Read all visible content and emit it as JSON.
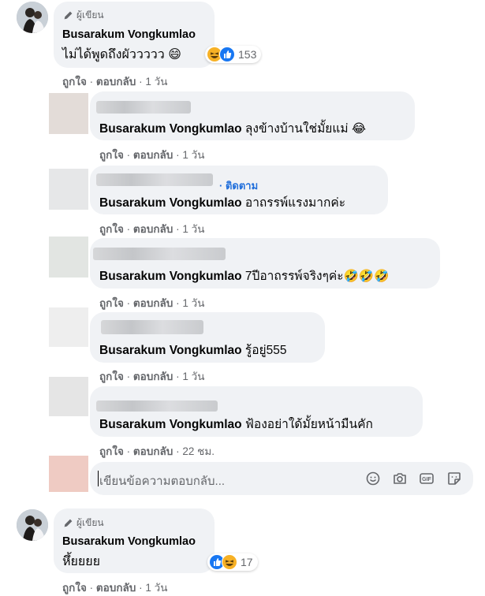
{
  "author_badge_label": "ผู้เขียน",
  "actions": {
    "like": "ถูกใจ",
    "reply": "ตอบกลับ",
    "sep": "·"
  },
  "comment1": {
    "author": "Busarakum Vongkumlao",
    "text": "ไม่ได้พูดถึงผัววววว 😄",
    "reaction_count": "153",
    "time": "1 วัน"
  },
  "replies": [
    {
      "author": "Busarakum Vongkumlao",
      "text": "ลุงข้างบ้านใช่มั้ยแม่ 😂",
      "time": "1 วัน"
    },
    {
      "follow_label": "ติดตาม",
      "author": "Busarakum Vongkumlao",
      "text": "อาถรรพ์แรงมากค่ะ",
      "time": "1 วัน"
    },
    {
      "author": "Busarakum Vongkumlao",
      "text": "7ปีอาถรรพ์จริงๆค่ะ🤣🤣🤣",
      "time": "1 วัน"
    },
    {
      "author": "Busarakum Vongkumlao",
      "text": "รู้อยู่555",
      "time": "1 วัน"
    },
    {
      "author": "Busarakum Vongkumlao",
      "text": "ฟ้องอย่าใด้มั้ยหน้ามืนคัก",
      "time": "22 ชม."
    }
  ],
  "reply_input": {
    "placeholder": "เขียนข้อความตอบกลับ..."
  },
  "reply_tools": [
    "emoji-icon",
    "camera-icon",
    "gif-icon",
    "sticker-icon"
  ],
  "comment2": {
    "author": "Busarakum Vongkumlao",
    "text": "หึ้ยยยย",
    "reaction_count": "17",
    "time": "1 วัน"
  },
  "colors": {
    "bubble": "#f0f2f5",
    "secondary_text": "#65676b",
    "link_blue": "#216fdb",
    "like_blue": "#1877f2",
    "haha_yellow": "#f7b125"
  }
}
